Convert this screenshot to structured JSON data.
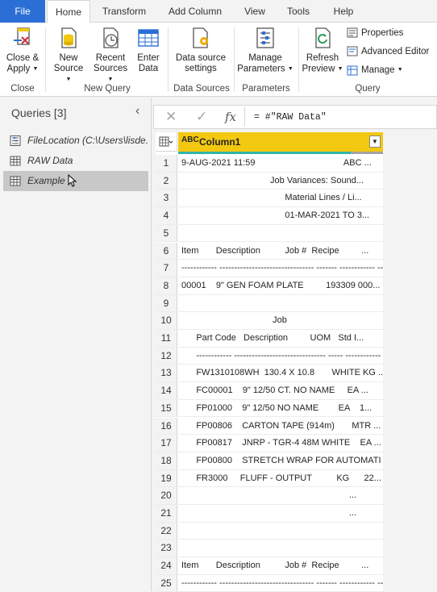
{
  "tabs": [
    "File",
    "Home",
    "Transform",
    "Add Column",
    "View",
    "Tools",
    "Help"
  ],
  "ribbon": {
    "close_apply": [
      "Close &",
      "Apply"
    ],
    "new_source": [
      "New",
      "Source"
    ],
    "recent_sources": [
      "Recent",
      "Sources"
    ],
    "enter_data": [
      "Enter",
      "Data"
    ],
    "data_source_settings": [
      "Data source",
      "settings"
    ],
    "manage_parameters": [
      "Manage",
      "Parameters"
    ],
    "refresh_preview": [
      "Refresh",
      "Preview"
    ],
    "properties": "Properties",
    "advanced_editor": "Advanced Editor",
    "manage": "Manage",
    "groups": {
      "close": "Close",
      "new_query": "New Query",
      "data_sources": "Data Sources",
      "parameters": "Parameters",
      "query": "Query"
    }
  },
  "queries": {
    "header": "Queries [3]",
    "items": [
      {
        "label": "FileLocation (C:\\Users\\lisde..."
      },
      {
        "label": "RAW Data"
      },
      {
        "label": "Example"
      }
    ]
  },
  "formula": {
    "text": "= #\"RAW Data\""
  },
  "grid": {
    "type_badge": "ABC",
    "column": "Column1",
    "rows": [
      {
        "n": "1",
        "v": "9-AUG-2021 11:59                                    ABC ..."
      },
      {
        "n": "2",
        "v": "                                    Job Variances: Sound..."
      },
      {
        "n": "3",
        "v": "                                          Material Lines / Li..."
      },
      {
        "n": "4",
        "v": "                                          01-MAR-2021 TO 3..."
      },
      {
        "n": "5",
        "v": ""
      },
      {
        "n": "6",
        "v": "Item       Description          Job #  Recipe         ..."
      },
      {
        "n": "7",
        "v": "------------ -------------------------------- ------- ------------ -------..."
      },
      {
        "n": "8",
        "v": "00001    9\" GEN FOAM PLATE         193309 000..."
      },
      {
        "n": "9",
        "v": ""
      },
      {
        "n": "10",
        "v": "                                     Job"
      },
      {
        "n": "11",
        "v": "      Part Code   Description         UOM   Std I..."
      },
      {
        "n": "12",
        "v": "      ------------ ------------------------------- ----- ------------ ---..."
      },
      {
        "n": "13",
        "v": "      FW1310108WH  130.4 X 10.8       WHITE KG ..."
      },
      {
        "n": "14",
        "v": "      FC00001    9\" 12/50 CT. NO NAME     EA ..."
      },
      {
        "n": "15",
        "v": "      FP01000    9\" 12/50 NO NAME        EA    1..."
      },
      {
        "n": "16",
        "v": "      FP00806    CARTON TAPE (914m)       MTR ..."
      },
      {
        "n": "17",
        "v": "      FP00817    JNRP - TGR-4 48M WHITE    EA ..."
      },
      {
        "n": "18",
        "v": "      FP00800    STRETCH WRAP FOR AUTOMATI ..."
      },
      {
        "n": "19",
        "v": "      FR3000     FLUFF - OUTPUT          KG      22..."
      },
      {
        "n": "20",
        "v": "                                                                    ..."
      },
      {
        "n": "21",
        "v": "                                                                    ..."
      },
      {
        "n": "22",
        "v": ""
      },
      {
        "n": "23",
        "v": ""
      },
      {
        "n": "24",
        "v": "Item       Description          Job #  Recipe         ..."
      },
      {
        "n": "25",
        "v": "------------ -------------------------------- ------- ------------ -------..."
      }
    ]
  },
  "colors": {
    "file_tab": "#2b6fd6",
    "column_header": "#f2c811",
    "quality_bar": "#30b4a9"
  }
}
